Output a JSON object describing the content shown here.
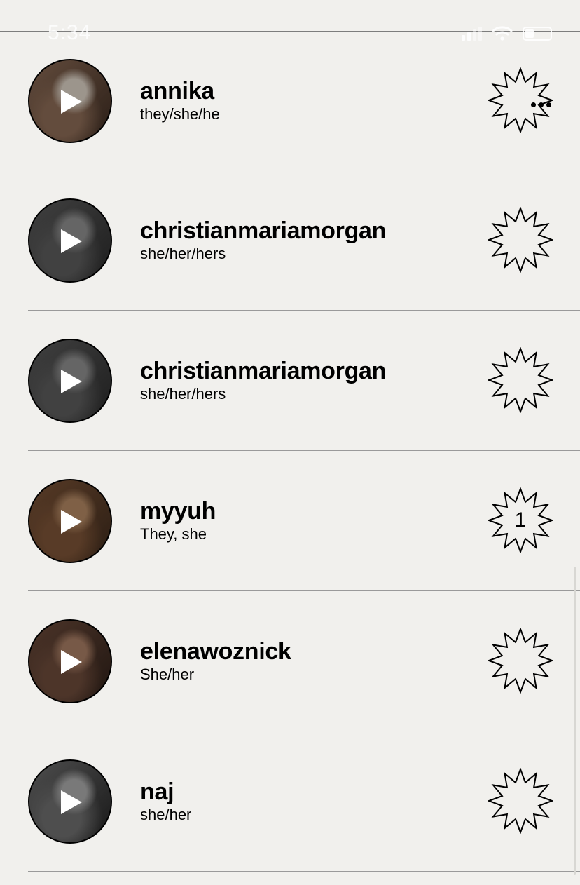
{
  "status_bar": {
    "time": "5:34"
  },
  "users": [
    {
      "username": "annika",
      "pronouns": "they/she/he",
      "avatar_colors": [
        "#8a6a55",
        "#3b2a20",
        "#d9cfc3"
      ],
      "reaction_count": "",
      "has_more_menu": true
    },
    {
      "username": "christianmariamorgan",
      "pronouns": "she/her/hers",
      "avatar_colors": [
        "#5a5a5a",
        "#2a2a2a",
        "#8c8c8c"
      ],
      "reaction_count": "",
      "has_more_menu": false
    },
    {
      "username": "christianmariamorgan",
      "pronouns": "she/her/hers",
      "avatar_colors": [
        "#5a5a5a",
        "#2a2a2a",
        "#8c8c8c"
      ],
      "reaction_count": "",
      "has_more_menu": false
    },
    {
      "username": "myyuh",
      "pronouns": "They, she",
      "avatar_colors": [
        "#7a5236",
        "#3d2a1c",
        "#b08662"
      ],
      "reaction_count": "1",
      "has_more_menu": false
    },
    {
      "username": "elenawoznick",
      "pronouns": "She/her",
      "avatar_colors": [
        "#6b4a3a",
        "#2d1f18",
        "#a67c63"
      ],
      "reaction_count": "",
      "has_more_menu": false
    },
    {
      "username": "naj",
      "pronouns": "she/her",
      "avatar_colors": [
        "#6d6d6d",
        "#222222",
        "#a8a8a8"
      ],
      "reaction_count": "",
      "has_more_menu": false
    }
  ],
  "icons": {
    "play": "play-icon",
    "reaction": "starburst-icon",
    "more": "more-dots-icon"
  },
  "colors": {
    "background": "#f1f0ed",
    "divider": "#9a9a9a",
    "text": "#000000"
  }
}
